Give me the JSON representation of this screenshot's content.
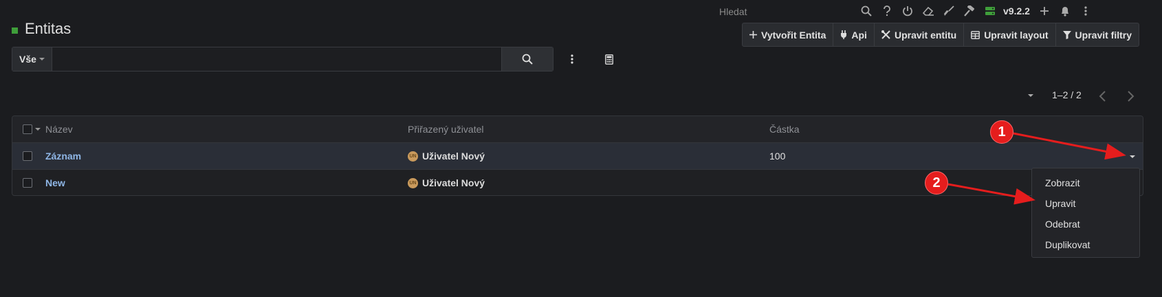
{
  "topbar": {
    "search_placeholder": "Hledat",
    "version": "v9.2.2",
    "icons": [
      "search-icon",
      "help-icon",
      "power-icon",
      "eraser-icon",
      "broom-icon",
      "hammer-icon",
      "server-icon",
      "plus-icon",
      "bell-icon",
      "more-icon"
    ]
  },
  "page": {
    "title": "Entitas"
  },
  "actions": [
    {
      "label": "Vytvořit Entita",
      "icon": "plus-icon"
    },
    {
      "label": "Api",
      "icon": "plug-icon"
    },
    {
      "label": "Upravit entitu",
      "icon": "tools-icon"
    },
    {
      "label": "Upravit layout",
      "icon": "table-icon"
    },
    {
      "label": "Upravit filtry",
      "icon": "filter-icon"
    }
  ],
  "search": {
    "filter_label": "Vše",
    "value": ""
  },
  "pagination": {
    "text": "1–2 / 2"
  },
  "table": {
    "columns": [
      "Název",
      "Přiřazený uživatel",
      "Částka"
    ],
    "rows": [
      {
        "name": "Záznam",
        "user": "Uživatel Nový",
        "user_initials": "UN",
        "amount": "100"
      },
      {
        "name": "New",
        "user": "Uživatel Nový",
        "user_initials": "UN",
        "amount": ""
      }
    ]
  },
  "row_menu": {
    "items": [
      "Zobrazit",
      "Upravit",
      "Odebrat",
      "Duplikovat"
    ]
  },
  "annotations": {
    "badge_1": "1",
    "badge_2": "2",
    "color": "#e51d1d"
  },
  "colors": {
    "accent": "#3f9e3a",
    "link": "#8fb6e6",
    "background": "#1b1c1f"
  }
}
